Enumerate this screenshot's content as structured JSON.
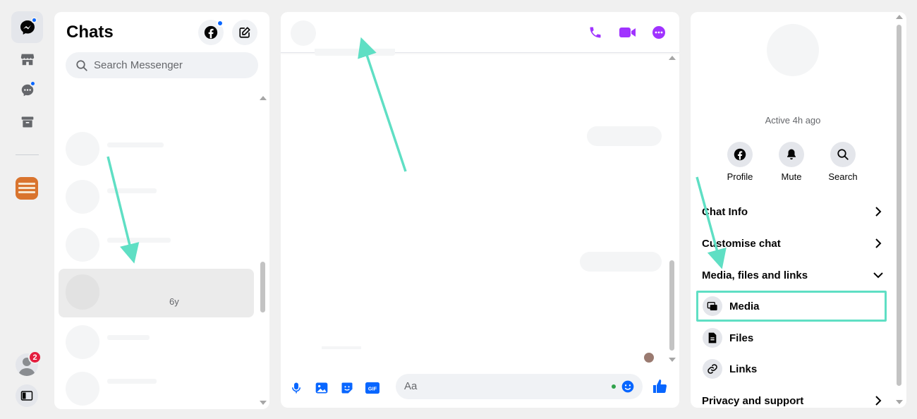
{
  "rail": {
    "items": [
      {
        "name": "chats-icon",
        "active": true,
        "badge": true
      },
      {
        "name": "marketplace-icon",
        "active": false,
        "badge": false
      },
      {
        "name": "requests-icon",
        "active": false,
        "badge": true
      },
      {
        "name": "archive-icon",
        "active": false,
        "badge": false
      }
    ],
    "user_badge_count": "2"
  },
  "chats": {
    "title": "Chats",
    "search_placeholder": "Search Messenger",
    "selected_time": "6y"
  },
  "composer": {
    "placeholder": "Aa"
  },
  "info": {
    "status": "Active 4h ago",
    "actions": [
      {
        "label": "Profile",
        "icon": "facebook-icon"
      },
      {
        "label": "Mute",
        "icon": "bell-icon"
      },
      {
        "label": "Search",
        "icon": "search-icon"
      }
    ],
    "sections": [
      {
        "label": "Chat Info",
        "icon": "chevron-right-icon"
      },
      {
        "label": "Customise chat",
        "icon": "chevron-right-icon"
      },
      {
        "label": "Media, files and links",
        "icon": "chevron-down-icon"
      }
    ],
    "sub_items": [
      {
        "label": "Media",
        "icon": "media-icon",
        "highlighted": true
      },
      {
        "label": "Files",
        "icon": "file-icon",
        "highlighted": false
      },
      {
        "label": "Links",
        "icon": "link-icon",
        "highlighted": false
      }
    ],
    "privacy_label": "Privacy and support"
  },
  "colors": {
    "accent_purple": "#a033ff",
    "accent_blue": "#0866ff",
    "annotation_teal": "#5fdfc4",
    "badge_red": "#e41e3f"
  }
}
